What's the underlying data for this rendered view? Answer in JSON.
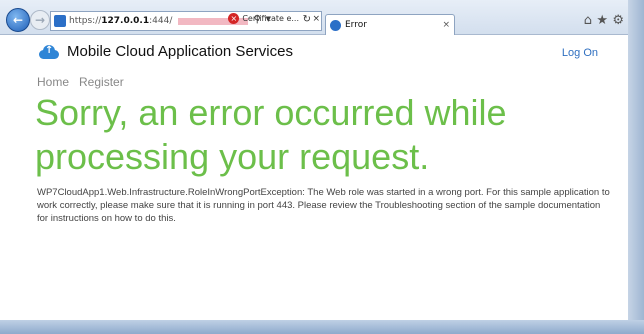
{
  "browser": {
    "url_prefix": "https://",
    "url_host": "127.0.0.1",
    "url_rest": ":444/",
    "certificate_label": "Certificate e...",
    "tab_label": "Error"
  },
  "site": {
    "brand": "Mobile Cloud Application Services",
    "logon": "Log On",
    "menu": [
      {
        "label": "Home"
      },
      {
        "label": "Register"
      }
    ]
  },
  "error": {
    "title": "Sorry, an error occurred while processing your request.",
    "detail": "WP7CloudApp1.Web.Infrastructure.RoleInWrongPortException: The Web role was started in a wrong port. For this sample application to work correctly, please make sure that it is running in port 443. Please review the Troubleshooting section of the sample documentation for instructions on how to do this."
  },
  "colors": {
    "accent_green": "#6cbf4a",
    "link_blue": "#2f6fc0"
  }
}
